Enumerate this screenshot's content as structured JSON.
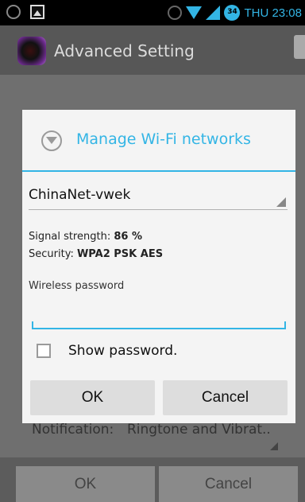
{
  "status_bar": {
    "time": "THU 23:08",
    "battery_level": "34",
    "icons": [
      "debug-icon",
      "photo-icon",
      "alarm-icon",
      "wifi-icon",
      "signal-icon",
      "battery-icon"
    ]
  },
  "action_bar": {
    "title": "Advanced Setting"
  },
  "underlying": {
    "notification_label": "Notification:",
    "notification_value": "Ringtone and Vibrat..",
    "ok_label": "OK",
    "cancel_label": "Cancel"
  },
  "dialog": {
    "title": "Manage Wi-Fi networks",
    "ssid": "ChinaNet-vwek",
    "signal_label": "Signal strength:",
    "signal_value": "86 %",
    "security_label": "Security:",
    "security_value": "WPA2 PSK AES",
    "password_label": "Wireless password",
    "password_value": "",
    "show_password_label": "Show password.",
    "show_password_checked": false,
    "ok_label": "OK",
    "cancel_label": "Cancel"
  },
  "colors": {
    "accent": "#33b5e5",
    "dim_background": "#6f6f6f",
    "dialog_background": "#f4f4f4"
  }
}
